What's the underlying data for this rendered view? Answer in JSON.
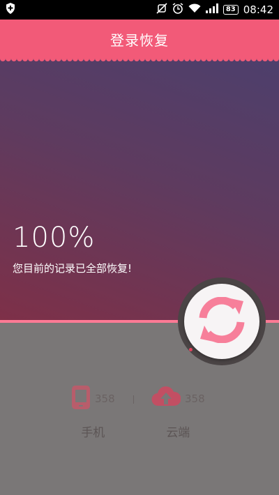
{
  "status_bar": {
    "battery": "83",
    "time": "08:42",
    "icons": [
      "shield-icon",
      "mute-icon",
      "alarm-icon",
      "wifi-icon",
      "signal-icon",
      "battery-icon"
    ]
  },
  "header": {
    "title": "登录恢复"
  },
  "progress": {
    "percent_text": "100%",
    "message": "您目前的记录已全部恢复!",
    "fraction": 1.0
  },
  "stats": [
    {
      "count": "358",
      "label": "手机",
      "icon": "phone-icon"
    },
    {
      "count": "358",
      "label": "云端",
      "icon": "cloud-upload-icon"
    }
  ],
  "sync_button": {
    "icon": "sync-icon"
  },
  "colors": {
    "accent": "#f25a78",
    "icon_phone": "#b85d6b",
    "icon_cloud": "#c24f63",
    "sync_icon": "#f77f9a",
    "background": "#7a7777"
  }
}
